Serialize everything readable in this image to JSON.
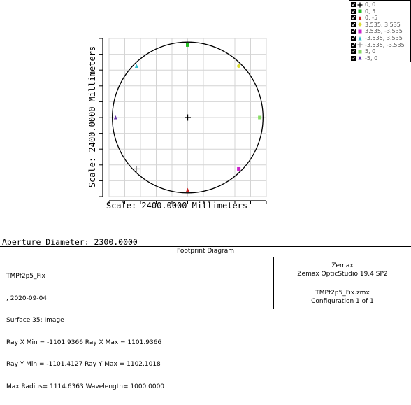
{
  "plot": {
    "y_scale_label": "Scale: 2400.0000 Millimeters",
    "x_scale_label": "Scale: 2400.0000 Millimeters",
    "aperture_radius_mm": 1150,
    "grid_divisions": 10
  },
  "legend": {
    "items": [
      {
        "label": "0, 0",
        "color": "#000000",
        "marker": "plus"
      },
      {
        "label": "0, 5",
        "color": "#22bb22",
        "marker": "square"
      },
      {
        "label": "0, -5",
        "color": "#cc2222",
        "marker": "triangle"
      },
      {
        "label": "3.535, 3.535",
        "color": "#dddd33",
        "marker": "circle"
      },
      {
        "label": "3.535, -3.535",
        "color": "#cc22cc",
        "marker": "square"
      },
      {
        "label": "-3.535, 3.535",
        "color": "#33bbcc",
        "marker": "triangle"
      },
      {
        "label": "-3.535, -3.535",
        "color": "#999999",
        "marker": "plus"
      },
      {
        "label": "5, 0",
        "color": "#88dd66",
        "marker": "square"
      },
      {
        "label": "-5, 0",
        "color": "#6633aa",
        "marker": "triangle"
      }
    ]
  },
  "chart_data": {
    "type": "scatter",
    "title": "Footprint Diagram",
    "xlabel": "Scale: 2400.0000 Millimeters",
    "ylabel": "Scale: 2400.0000 Millimeters",
    "xlim": [
      -1200,
      1200
    ],
    "ylim": [
      -1200,
      1200
    ],
    "grid": true,
    "series": [
      {
        "name": "0, 0",
        "x": [
          0
        ],
        "y": [
          0
        ]
      },
      {
        "name": "0, 5",
        "x": [
          0
        ],
        "y": [
          1100
        ]
      },
      {
        "name": "0, -5",
        "x": [
          0
        ],
        "y": [
          -1100
        ]
      },
      {
        "name": "3.535, 3.535",
        "x": [
          780
        ],
        "y": [
          780
        ]
      },
      {
        "name": "3.535, -3.535",
        "x": [
          780
        ],
        "y": [
          -780
        ]
      },
      {
        "name": "-3.535, 3.535",
        "x": [
          -780
        ],
        "y": [
          780
        ]
      },
      {
        "name": "-3.535, -3.535",
        "x": [
          -780
        ],
        "y": [
          -780
        ]
      },
      {
        "name": "5, 0",
        "x": [
          1100
        ],
        "y": [
          0
        ]
      },
      {
        "name": "-5, 0",
        "x": [
          -1100
        ],
        "y": [
          0
        ]
      }
    ]
  },
  "aperture": {
    "text": "Aperture Diameter: 2300.0000"
  },
  "info": {
    "title": "Footprint Diagram",
    "left_lines": [
      "TMPf2p5_Fix",
      ", 2020-09-04",
      "Surface 35: Image",
      "Ray X Min = -1101.9366 Ray X Max = 1101.9366",
      "Ray Y Min = -1101.4127 Ray Y Max = 1102.1018",
      "Max Radius= 1114.6363 Wavelength= 1000.0000"
    ],
    "company": "Zemax",
    "product": "Zemax OpticStudio 19.4 SP2",
    "file": "TMPf2p5_Fix.zmx",
    "config": "Configuration 1 of 1"
  }
}
